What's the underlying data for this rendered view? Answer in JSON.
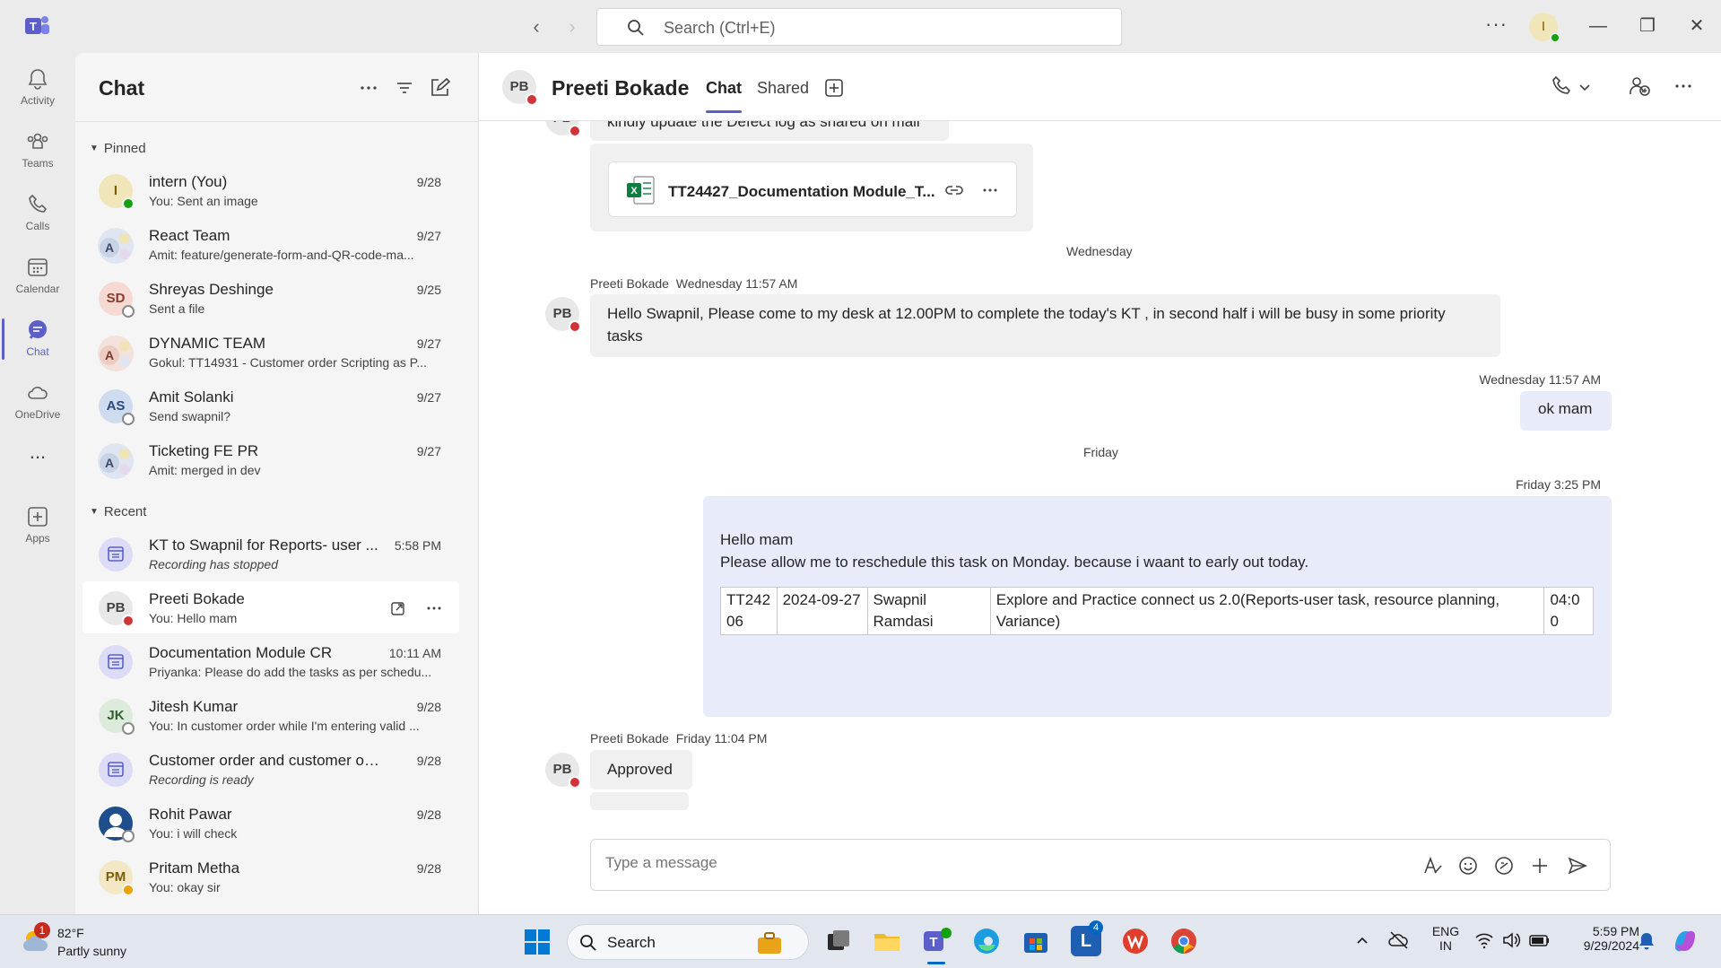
{
  "titlebar": {
    "search_placeholder": "Search (Ctrl+E)",
    "me_initial": "I"
  },
  "rail": {
    "items": [
      {
        "label": "Activity"
      },
      {
        "label": "Teams"
      },
      {
        "label": "Calls"
      },
      {
        "label": "Calendar"
      },
      {
        "label": "Chat"
      },
      {
        "label": "OneDrive"
      },
      {
        "label": "Apps"
      }
    ],
    "more": "..."
  },
  "chat_list": {
    "title": "Chat",
    "pinned_label": "Pinned",
    "recent_label": "Recent",
    "pinned": [
      {
        "initials": "I",
        "name": "intern (You)",
        "preview": "You: Sent an image",
        "time": "9/28"
      },
      {
        "initials": "A",
        "name": "React Team",
        "preview": "Amit: feature/generate-form-and-QR-code-ma...",
        "time": "9/27"
      },
      {
        "initials": "SD",
        "name": "Shreyas Deshinge",
        "preview": "Sent a file",
        "time": "9/25"
      },
      {
        "initials": "A",
        "name": "DYNAMIC TEAM",
        "preview": "Gokul: TT14931 - Customer order Scripting as P...",
        "time": "9/27"
      },
      {
        "initials": "AS",
        "name": "Amit Solanki",
        "preview": "Send swapnil?",
        "time": "9/27"
      },
      {
        "initials": "A",
        "name": "Ticketing FE PR",
        "preview": "Amit: merged in dev",
        "time": "9/27"
      }
    ],
    "recent": [
      {
        "name": "KT to Swapnil for Reports- user ...",
        "preview": "Recording has stopped",
        "time": "5:58 PM"
      },
      {
        "initials": "PB",
        "name": "Preeti Bokade",
        "preview": "You: Hello mam"
      },
      {
        "name": "Documentation Module CR",
        "preview": "Priyanka: Please do add the tasks as per schedu...",
        "time": "10:11 AM"
      },
      {
        "initials": "JK",
        "name": "Jitesh Kumar",
        "preview": "You: In customer order while I'm entering valid ...",
        "time": "9/28"
      },
      {
        "name": "Customer order and customer orde...",
        "preview": "Recording is ready",
        "time": "9/28"
      },
      {
        "name": "Rohit Pawar",
        "preview": "You: i will check",
        "time": "9/28"
      },
      {
        "initials": "PM",
        "name": "Pritam Metha",
        "preview": "You: okay sir",
        "time": "9/28"
      }
    ]
  },
  "conversation": {
    "contact_initials": "PB",
    "contact_name": "Preeti Bokade",
    "tabs": [
      "Chat",
      "Shared"
    ],
    "msg_partial": "kindly update the Defect log as shared on mail",
    "file_name": "TT24427_Documentation Module_T...",
    "sep_wednesday": "Wednesday",
    "sender_1": "Preeti Bokade",
    "time_1": "Wednesday 11:57 AM",
    "msg_1": "Hello Swapnil, Please come to my desk at 12.00PM to complete the today's KT , in second half i will be busy in some priority tasks",
    "my_time_1": "Wednesday 11:57 AM",
    "my_msg_1": "ok mam",
    "sep_friday": "Friday",
    "my_time_2": "Friday 3:25 PM",
    "my_msg_2_line1": "Hello mam",
    "my_msg_2_line2": "Please allow me to reschedule this task on Monday. because i waant to early out today.",
    "task_row": {
      "id": "TT24206",
      "date": "2024-09-27",
      "assignee": "Swapnil Ramdasi",
      "desc": "Explore and Practice connect us 2.0(Reports-user task, resource planning, Variance)",
      "hours": "04:00"
    },
    "sender_2": "Preeti Bokade",
    "time_2": "Friday 11:04 PM",
    "msg_2": "Approved",
    "compose_placeholder": "Type a message"
  },
  "taskbar": {
    "weather_badge": "1",
    "weather_temp": "82°F",
    "weather_desc": "Partly sunny",
    "search_label": "Search",
    "lang_1": "ENG",
    "lang_2": "IN",
    "time": "5:59 PM",
    "date": "9/29/2024",
    "badge_l": "4"
  },
  "colors": {
    "accent": "#5b5fc7",
    "presence_available": "#13a10e",
    "presence_busy": "#d13438",
    "my_bubble": "#e8ebfa"
  }
}
